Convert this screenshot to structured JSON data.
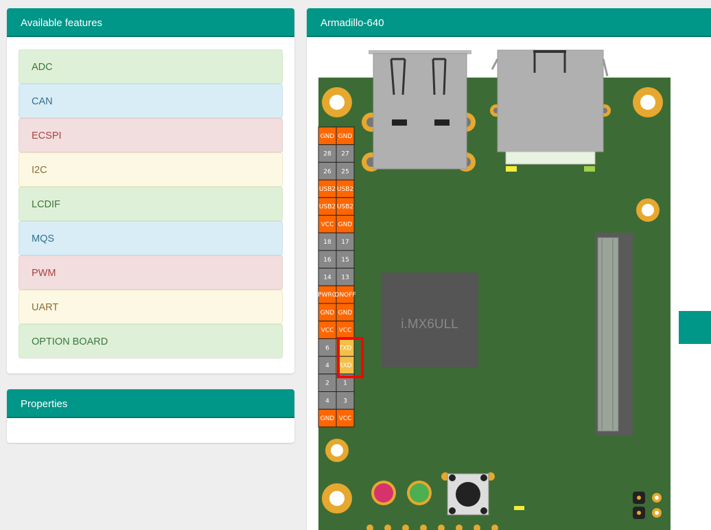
{
  "features": {
    "title": "Available features",
    "items": [
      {
        "label": "ADC",
        "color": "green"
      },
      {
        "label": "CAN",
        "color": "blue"
      },
      {
        "label": "ECSPI",
        "color": "red"
      },
      {
        "label": "I2C",
        "color": "yellow"
      },
      {
        "label": "LCDIF",
        "color": "green"
      },
      {
        "label": "MQS",
        "color": "blue"
      },
      {
        "label": "PWM",
        "color": "red"
      },
      {
        "label": "UART",
        "color": "yellow"
      },
      {
        "label": "OPTION BOARD",
        "color": "green"
      }
    ]
  },
  "properties": {
    "title": "Properties"
  },
  "board": {
    "title": "Armadillo-640",
    "chip_label": "i.MX6ULL",
    "pins": {
      "left": [
        "GND",
        "28",
        "26",
        "USB2",
        "USB2",
        "VCC",
        "18",
        "16",
        "14",
        "PWRO",
        "GND",
        "VCC",
        "6",
        "4",
        "2",
        "4",
        "GND"
      ],
      "right": [
        "GND",
        "27",
        "25",
        "USB2",
        "USB2",
        "GND",
        "17",
        "15",
        "13",
        "ONOFF",
        "GND",
        "VCC",
        "TXD",
        "RXD",
        "1",
        "3",
        "VCC"
      ]
    }
  },
  "colors": {
    "accent": "#009688",
    "pcb": "#3d6b35",
    "pin_power": "#ff6600",
    "pin_gpio": "#888888",
    "pin_uart": "#f4c04a",
    "highlight": "#ff0000",
    "pad_gold": "#e6a82e",
    "led_red": "#d6336c",
    "led_green": "#4caf50"
  }
}
